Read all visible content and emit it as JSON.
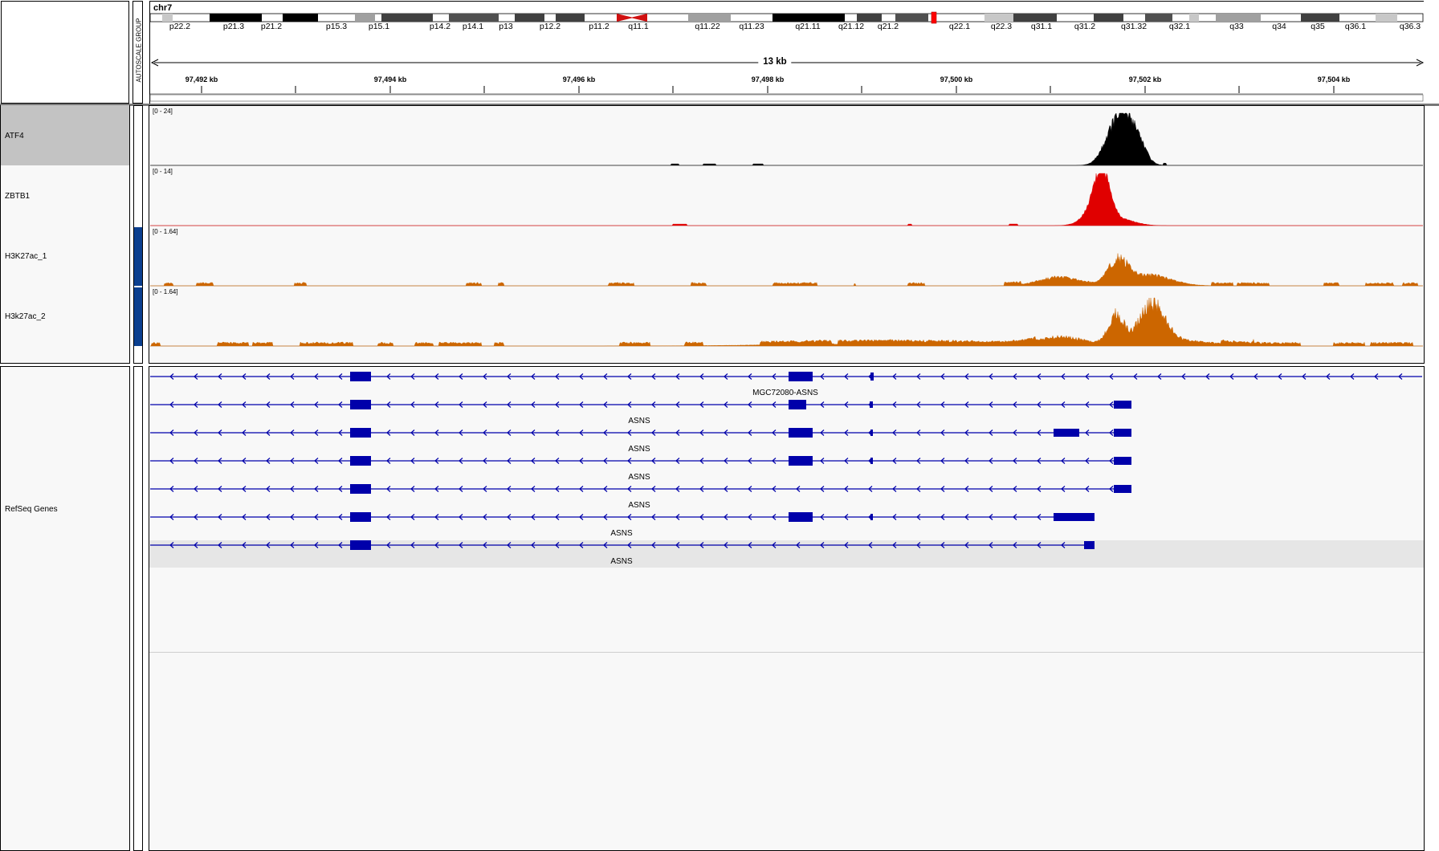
{
  "header": {
    "chromosome": "chr7",
    "autoscale_label": "AUTOSCALE GROUP",
    "span_label": "13 kb"
  },
  "cytobands": [
    "p22.2",
    "p21.3",
    "p21.2",
    "p15.3",
    "p15.1",
    "p14.2",
    "p14.1",
    "p13",
    "p12.2",
    "p11.2",
    "q11.1",
    "q11.22",
    "q11.23",
    "q21.11",
    "q21.12",
    "q21.2",
    "q22.1",
    "q22.3",
    "q31.1",
    "q31.2",
    "q31.32",
    "q32.1",
    "q33",
    "q34",
    "q35",
    "q36.1",
    "q36.3"
  ],
  "ruler_ticks": [
    "97,492 kb",
    "97,494 kb",
    "97,496 kb",
    "97,498 kb",
    "97,500 kb",
    "97,502 kb",
    "97,504 kb"
  ],
  "tracks": [
    {
      "name": "ATF4",
      "range": "[0 - 24]",
      "color": "#000000",
      "selected": true
    },
    {
      "name": "ZBTB1",
      "range": "[0 - 14]",
      "color": "#e00000",
      "selected": false
    },
    {
      "name": "H3K27ac_1",
      "range": "[0 - 1.64]",
      "color": "#cc6600",
      "selected": false
    },
    {
      "name": "H3k27ac_2",
      "range": "[0 - 1.64]",
      "color": "#cc6600",
      "selected": false
    }
  ],
  "gene_track": {
    "name": "RefSeq Genes",
    "color": "#0000aa",
    "genes": [
      {
        "label": "MGC72080-ASNS"
      },
      {
        "label": "ASNS"
      },
      {
        "label": "ASNS"
      },
      {
        "label": "ASNS"
      },
      {
        "label": "ASNS"
      },
      {
        "label": "ASNS"
      },
      {
        "label": "ASNS"
      }
    ]
  }
}
